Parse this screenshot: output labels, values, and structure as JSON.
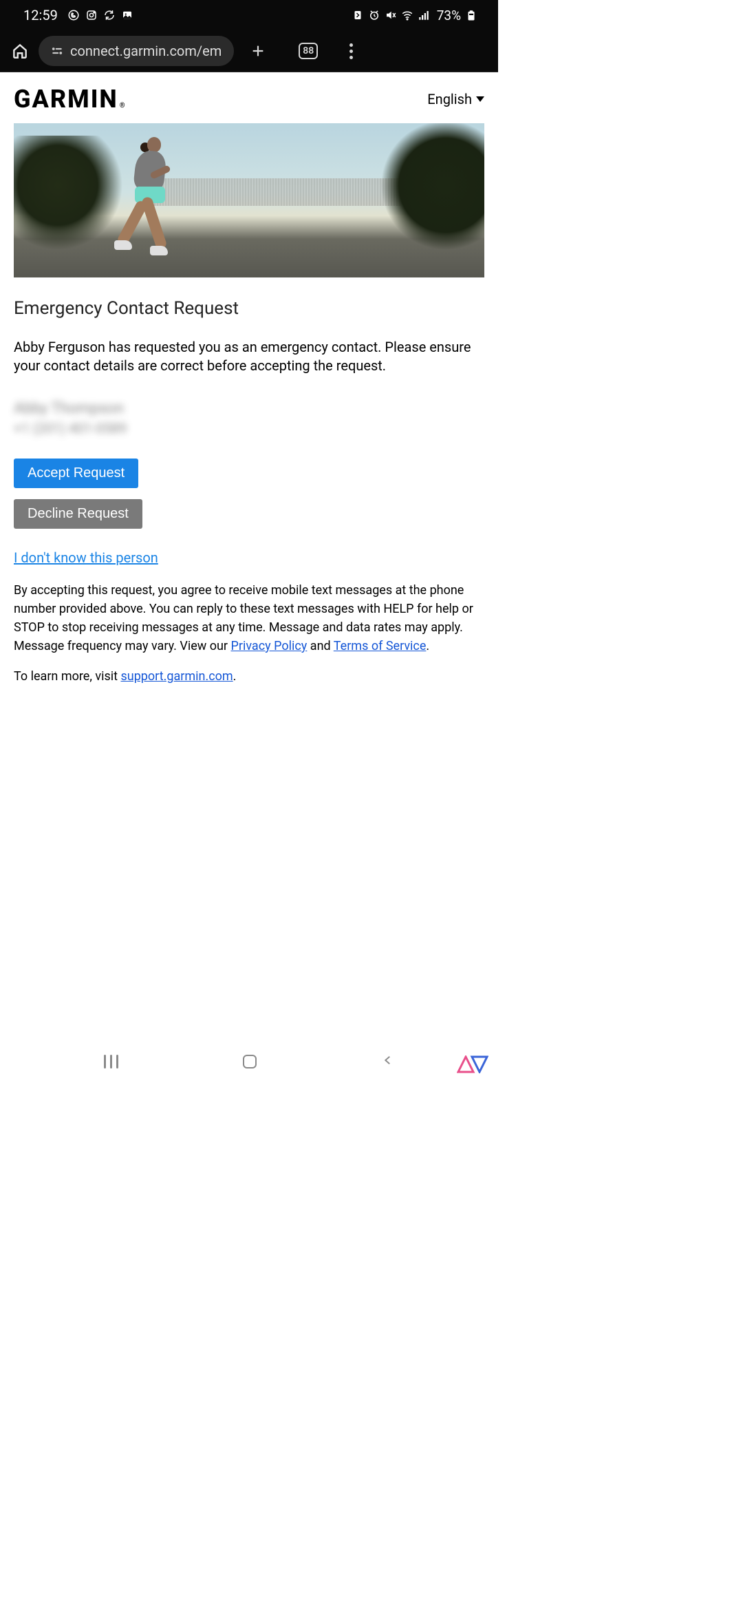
{
  "status": {
    "time": "12:59",
    "battery_pct": "73%"
  },
  "browser": {
    "url": "connect.garmin.com/em",
    "tab_count": "88"
  },
  "header": {
    "logo_text": "GARMIN",
    "lang": "English"
  },
  "content": {
    "title": "Emergency Contact Request",
    "body": "Abby Ferguson has requested you as an emergency contact. Please ensure your contact details are correct before accepting the request.",
    "contact_name_blurred": "Abby Thompson",
    "contact_phone_blurred": "+1 (201) 401-0589",
    "accept_label": "Accept Request",
    "decline_label": "Decline Request",
    "unknown_label": "I don't know this person",
    "fine_print_pre": "By accepting this request, you agree to receive mobile text messages at the phone number provided above. You can reply to these text messages with HELP for help or STOP to stop receiving messages at any time. Message and data rates may apply. Message frequency may vary. View our ",
    "privacy": "Privacy Policy",
    "and": " and ",
    "tos": "Terms of Service",
    "period": ".",
    "learn_pre": "To learn more, visit ",
    "learn_link": "support.garmin.com",
    "learn_post": "."
  }
}
